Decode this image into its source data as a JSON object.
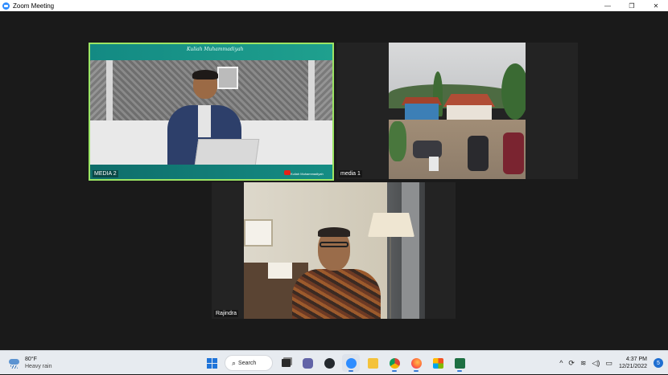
{
  "window": {
    "title": "Zoom Meeting",
    "controls": {
      "minimize": "—",
      "restore": "❐",
      "close": "✕"
    }
  },
  "tiles": [
    {
      "name": "MEDIA 2",
      "active_speaker": true,
      "banner_script": "Kuliah Muhammadiyah",
      "banner_channel": "Kuliah Muhammadiyah"
    },
    {
      "name": "media 1",
      "active_speaker": false
    },
    {
      "name": "Rajindra",
      "active_speaker": false
    }
  ],
  "taskbar": {
    "weather": {
      "temperature": "80°F",
      "condition": "Heavy rain"
    },
    "search_label": "Search",
    "apps": [
      "windows-start",
      "search",
      "task-view",
      "teams",
      "github-desktop",
      "zoom",
      "file-explorer",
      "chrome",
      "firefox",
      "windows-store",
      "excel"
    ],
    "active_app": "zoom",
    "clock": {
      "time": "4:37 PM",
      "date": "12/21/2022"
    },
    "notification_count": "5"
  },
  "colors": {
    "active_speaker_border": "#9be564",
    "zoom_blue": "#2d8cff",
    "banner_teal": "#138a83"
  }
}
